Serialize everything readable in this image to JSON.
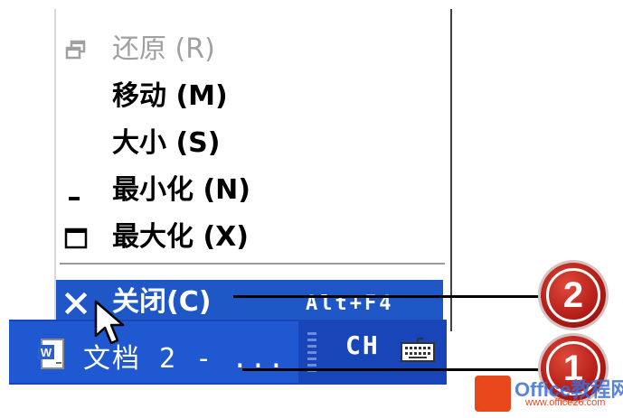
{
  "menu": {
    "items": [
      {
        "label": "还原 (R)",
        "icon": "restore-icon",
        "disabled": true
      },
      {
        "label": "移动 (M)",
        "icon": "",
        "disabled": false
      },
      {
        "label": "大小 (S)",
        "icon": "",
        "disabled": false
      },
      {
        "label": "最小化 (N)",
        "icon": "minimize-icon",
        "disabled": false
      },
      {
        "label": "最大化 (X)",
        "icon": "maximize-icon",
        "disabled": false
      }
    ],
    "close": {
      "label": "关闭(C)",
      "accelerator": "Alt+F4",
      "icon": "close-icon"
    }
  },
  "taskbar": {
    "task_label": "文档 2 - ...",
    "task_icon": "word-document-icon",
    "ime_label": "CH",
    "tray_icon": "keyboard-icon"
  },
  "callouts": [
    "2",
    "1"
  ],
  "watermark": {
    "title": "Office教程网",
    "subtitle": "www.office26.com"
  },
  "colors": {
    "highlight": "#1f58c6",
    "taskbar": "#1845b8",
    "badge": "#b51d18"
  }
}
